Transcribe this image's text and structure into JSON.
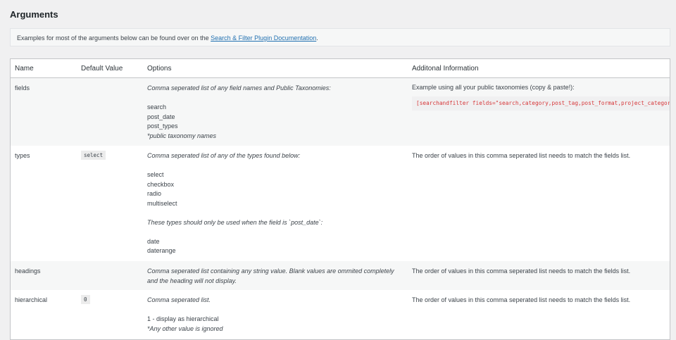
{
  "page": {
    "title": "Arguments"
  },
  "notice": {
    "text_before": "Examples for most of the arguments below can be found over on the ",
    "link": "Search & Filter Plugin Documentation",
    "text_after": "."
  },
  "table": {
    "headers": [
      "Name",
      "Default Value",
      "Options",
      "Additonal Information"
    ],
    "rows": [
      {
        "name": "fields",
        "default": "",
        "options_intro": "Comma seperated list of any field names and Public Taxonomies:",
        "options_list": [
          "search",
          "post_date",
          "post_types"
        ],
        "options_note": "*public taxonomy names",
        "info": "Example using all your public taxonomies (copy & paste!):",
        "info_code": "[searchandfilter fields=\"search,category,post_tag,post_format,project_category,"
      },
      {
        "name": "types",
        "default": "select",
        "options_intro": "Comma seperated list of any of the types found below:",
        "options_list": [
          "select",
          "checkbox",
          "radio",
          "multiselect"
        ],
        "options_note": "These types should only be used when the field is `post_date`:",
        "options_list2": [
          "date",
          "daterange"
        ],
        "info": "The order of values in this comma seperated list needs to match the fields list."
      },
      {
        "name": "headings",
        "default": "",
        "options_line1": "Comma seperated list containing any string value. Blank values are ommited completely",
        "options_line2": "and the heading will not display.",
        "info": "The order of values in this comma seperated list needs to match the fields list."
      },
      {
        "name": "hierarchical",
        "default": "0",
        "options_intro": "Comma seperated list.",
        "options_list": [
          "1 - display as hierarchical"
        ],
        "options_note": "*Any other value is ignored",
        "info": "The order of values in this comma seperated list needs to match the fields list."
      }
    ]
  }
}
